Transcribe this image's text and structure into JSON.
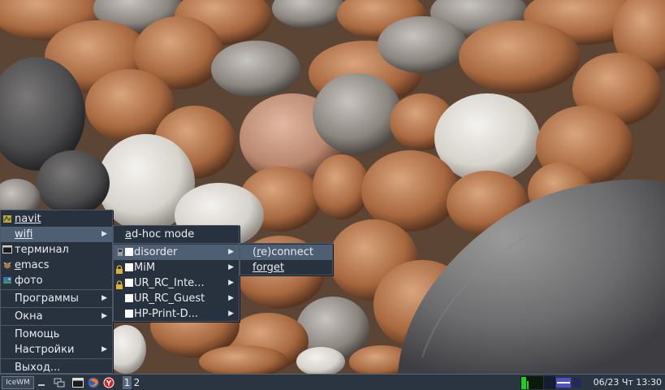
{
  "main_menu": {
    "items": [
      {
        "label": "navit",
        "icon": "map-icon"
      },
      {
        "label": "wifi",
        "icon": "none",
        "selected": true
      },
      {
        "label": "терминал",
        "icon": "terminal-icon"
      },
      {
        "label": "emacs",
        "icon": "emacs-gnu-icon"
      },
      {
        "label": "фото",
        "icon": "photo-icon"
      },
      {
        "label": "Программы"
      },
      {
        "label": "Окна"
      },
      {
        "label": "Помощь"
      },
      {
        "label": "Настройки"
      },
      {
        "label": "Выход..."
      }
    ]
  },
  "wifi_menu": {
    "adhoc": "ad-hoc mode",
    "networks": [
      {
        "label": "disorder",
        "selected": true
      },
      {
        "label": "MiM",
        "locked": true
      },
      {
        "label": "UR_RC_Inte...",
        "locked": true
      },
      {
        "label": "UR_RC_Guest"
      },
      {
        "label": "HP-Print-D..."
      }
    ]
  },
  "network_menu": {
    "items": [
      {
        "label": "(re)connect",
        "selected": true
      },
      {
        "label": "forget"
      }
    ]
  },
  "taskbar": {
    "start_label": "IceWM",
    "workspaces": [
      "1",
      "2"
    ],
    "active_workspace": "1",
    "clock": "06/23 Чт 13:30",
    "colors": {
      "cpu": "#22cc22",
      "net": "#4040c0"
    }
  }
}
